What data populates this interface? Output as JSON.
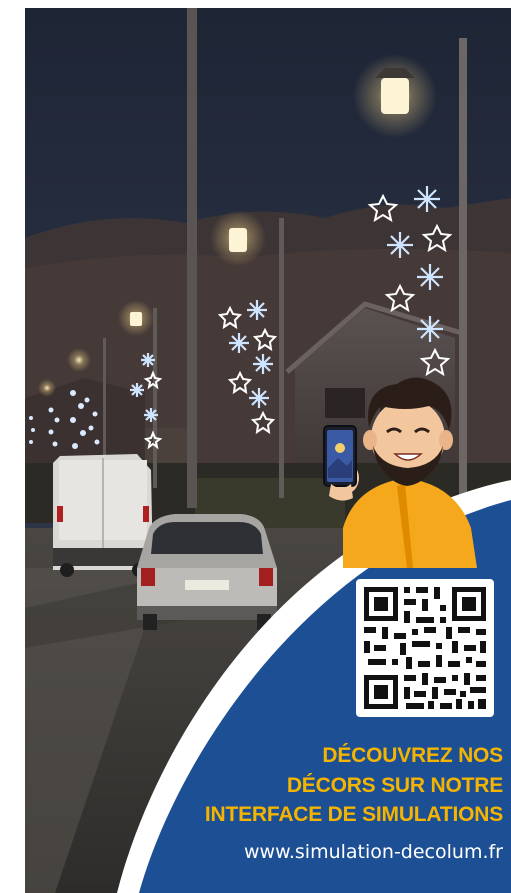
{
  "poster": {
    "headline_line1": "DÉCOUVREZ NOS",
    "headline_line2": "DÉCORS SUR NOTRE",
    "headline_line3": "INTERFACE DE SIMULATIONS",
    "url": "www.simulation-decolum.fr"
  },
  "colors": {
    "panel_blue": "#1d4f94",
    "accent_yellow": "#f4b400",
    "sky": "#252b3c"
  }
}
